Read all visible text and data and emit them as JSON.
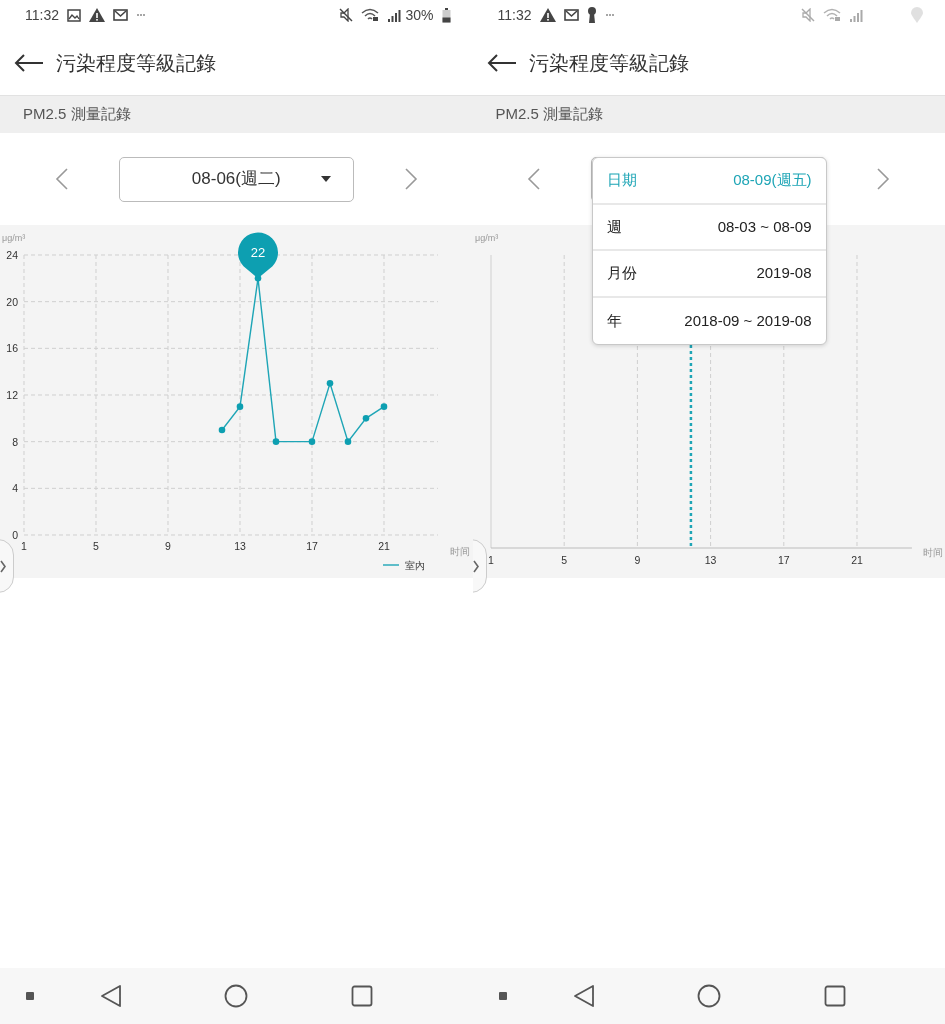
{
  "screens": [
    {
      "status_bar": {
        "time": "11:32",
        "dimmed": false,
        "notifications": [
          {
            "kind": "image"
          },
          {
            "kind": "warning"
          },
          {
            "kind": "mail"
          },
          {
            "kind": "more"
          }
        ],
        "system_icons": [
          {
            "kind": "mute"
          },
          {
            "kind": "wifi"
          },
          {
            "kind": "signal"
          }
        ],
        "battery": "30%"
      },
      "app_bar": {
        "title": "污染程度等級記錄"
      },
      "section": {
        "title": "PM2.5 測量記錄"
      },
      "date_selector": {
        "value": "08-06(週二)"
      },
      "chart": {
        "chart_data": {
          "type": "line",
          "xlabel": "时间",
          "ylabel": "μg/m³",
          "x": [
            12,
            13,
            14,
            15,
            17,
            18,
            19,
            20,
            21
          ],
          "series": [
            {
              "name": "室內",
              "color": "#1ea5b6",
              "marker": "circle",
              "values": [
                9,
                11,
                22,
                8,
                8,
                13,
                8,
                10,
                11
              ]
            }
          ],
          "xlim": [
            1,
            24
          ],
          "ylim": [
            0,
            24
          ],
          "xticks": [
            1,
            5,
            9,
            13,
            17,
            21
          ],
          "yticks": [
            0,
            4,
            8,
            12,
            16,
            20,
            24
          ],
          "grid": true,
          "annotations": [
            {
              "x": 14,
              "y": 22,
              "text": "22"
            }
          ]
        }
      }
    },
    {
      "status_bar": {
        "time": "11:32",
        "dimmed": true,
        "notifications": [
          {
            "kind": "warning"
          },
          {
            "kind": "mail"
          },
          {
            "kind": "keyhole"
          },
          {
            "kind": "more"
          }
        ],
        "system_icons": [
          {
            "kind": "mute"
          },
          {
            "kind": "wifi"
          },
          {
            "kind": "signal"
          },
          {
            "kind": "location"
          }
        ]
      },
      "app_bar": {
        "title": "污染程度等級記錄"
      },
      "section": {
        "title": "PM2.5 測量記錄"
      },
      "chart": {
        "unit": "μg/m³",
        "axis_title": "时间",
        "x_labels": [
          "1",
          "5",
          "9",
          "13",
          "17",
          "21"
        ],
        "cursor": {
          "level": 0.475
        }
      },
      "date_menu": {
        "items": [
          {
            "label": "日期",
            "value": "08-09(週五)",
            "selected": true
          },
          {
            "label": "週",
            "value": "08-03 ~ 08-09",
            "selected": false
          },
          {
            "label": "月份",
            "value": "2019-08",
            "selected": false
          },
          {
            "label": "年",
            "value": "2018-09 ~ 2019-08",
            "selected": false
          }
        ]
      }
    }
  ]
}
